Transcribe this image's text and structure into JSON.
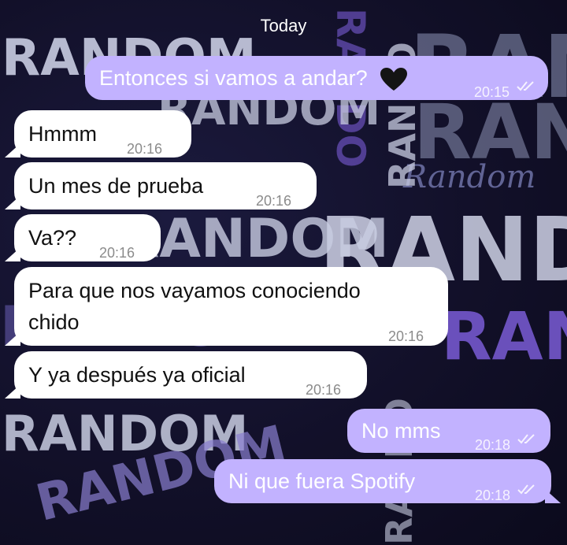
{
  "chat": {
    "date_label": "Today",
    "wallpaper_words": [
      "RANDOM",
      "RAN",
      "Random",
      "RAND",
      "RANDO"
    ],
    "messages": [
      {
        "id": "m1",
        "dir": "out",
        "text": "Entonces si vamos a andar?",
        "emoji": "black-heart-icon",
        "time": "20:15",
        "status": "read"
      },
      {
        "id": "m2",
        "dir": "in",
        "text": "Hmmm",
        "time": "20:16"
      },
      {
        "id": "m3",
        "dir": "in",
        "text": "Un mes de prueba",
        "time": "20:16"
      },
      {
        "id": "m4",
        "dir": "in",
        "text": "Va??",
        "time": "20:16"
      },
      {
        "id": "m5",
        "dir": "in",
        "lines": [
          "Para que nos vayamos conociendo",
          "chido"
        ],
        "time": "20:16"
      },
      {
        "id": "m6",
        "dir": "in",
        "text": "Y ya después ya oficial",
        "time": "20:16"
      },
      {
        "id": "m7",
        "dir": "out",
        "text": "No mms",
        "time": "20:18",
        "status": "read"
      },
      {
        "id": "m8",
        "dir": "out",
        "text": "Ni que fuera Spotify",
        "time": "20:18",
        "status": "read"
      }
    ]
  },
  "colors": {
    "background": "#121029",
    "incoming_bubble": "#ffffff",
    "outgoing_bubble": "#c2b2ff",
    "wallpaper_text": "#c9cde2",
    "wallpaper_accent": "#7a5cd6"
  }
}
